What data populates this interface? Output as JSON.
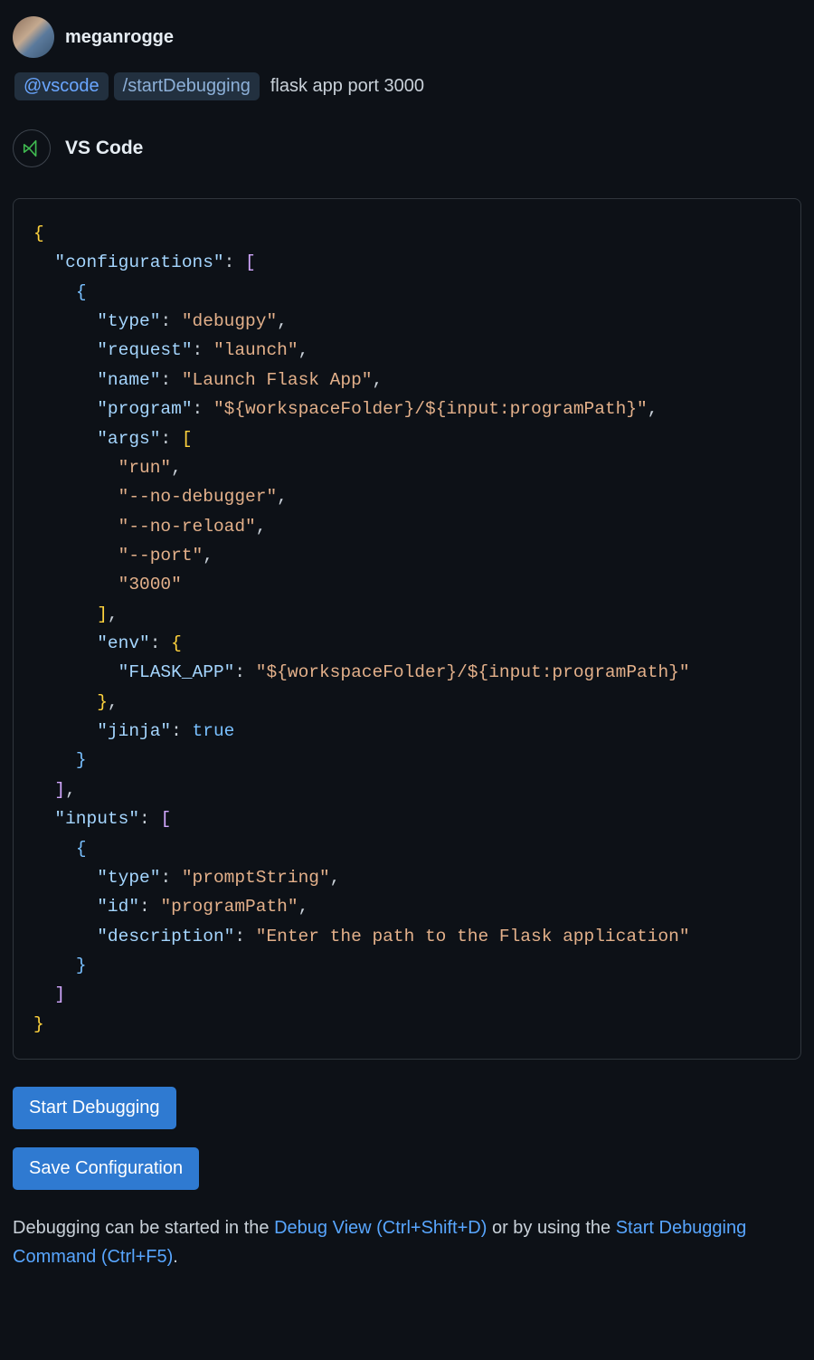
{
  "user": {
    "name": "meganrogge"
  },
  "prompt": {
    "agent_chip": "@vscode",
    "command_chip": "/startDebugging",
    "query_text": "flask app port 3000"
  },
  "agent": {
    "name": "VS Code"
  },
  "code": {
    "lines": [
      [
        [
          "{",
          "brace"
        ]
      ],
      [
        [
          "  ",
          ""
        ],
        [
          "\"configurations\"",
          "key"
        ],
        [
          ": ",
          "punct"
        ],
        [
          "[",
          "bracket-purple"
        ]
      ],
      [
        [
          "    ",
          ""
        ],
        [
          "{",
          "bracket-blue"
        ]
      ],
      [
        [
          "      ",
          ""
        ],
        [
          "\"type\"",
          "key"
        ],
        [
          ": ",
          "punct"
        ],
        [
          "\"debugpy\"",
          "string"
        ],
        [
          ",",
          "punct"
        ]
      ],
      [
        [
          "      ",
          ""
        ],
        [
          "\"request\"",
          "key"
        ],
        [
          ": ",
          "punct"
        ],
        [
          "\"launch\"",
          "string"
        ],
        [
          ",",
          "punct"
        ]
      ],
      [
        [
          "      ",
          ""
        ],
        [
          "\"name\"",
          "key"
        ],
        [
          ": ",
          "punct"
        ],
        [
          "\"Launch Flask App\"",
          "string"
        ],
        [
          ",",
          "punct"
        ]
      ],
      [
        [
          "      ",
          ""
        ],
        [
          "\"program\"",
          "key"
        ],
        [
          ": ",
          "punct"
        ],
        [
          "\"${workspaceFolder}/${input:programPath}\"",
          "string"
        ],
        [
          ",",
          "punct"
        ]
      ],
      [
        [
          "      ",
          ""
        ],
        [
          "\"args\"",
          "key"
        ],
        [
          ": ",
          "punct"
        ],
        [
          "[",
          "brace"
        ]
      ],
      [
        [
          "        ",
          ""
        ],
        [
          "\"run\"",
          "string"
        ],
        [
          ",",
          "punct"
        ]
      ],
      [
        [
          "        ",
          ""
        ],
        [
          "\"--no-debugger\"",
          "string"
        ],
        [
          ",",
          "punct"
        ]
      ],
      [
        [
          "        ",
          ""
        ],
        [
          "\"--no-reload\"",
          "string"
        ],
        [
          ",",
          "punct"
        ]
      ],
      [
        [
          "        ",
          ""
        ],
        [
          "\"--port\"",
          "string"
        ],
        [
          ",",
          "punct"
        ]
      ],
      [
        [
          "        ",
          ""
        ],
        [
          "\"3000\"",
          "string"
        ]
      ],
      [
        [
          "      ",
          ""
        ],
        [
          "]",
          "brace"
        ],
        [
          ",",
          "punct"
        ]
      ],
      [
        [
          "      ",
          ""
        ],
        [
          "\"env\"",
          "key"
        ],
        [
          ": ",
          "punct"
        ],
        [
          "{",
          "brace"
        ]
      ],
      [
        [
          "        ",
          ""
        ],
        [
          "\"FLASK_APP\"",
          "key"
        ],
        [
          ": ",
          "punct"
        ],
        [
          "\"${workspaceFolder}/${input:programPath}\"",
          "string"
        ]
      ],
      [
        [
          "      ",
          ""
        ],
        [
          "}",
          "brace"
        ],
        [
          ",",
          "punct"
        ]
      ],
      [
        [
          "      ",
          ""
        ],
        [
          "\"jinja\"",
          "key"
        ],
        [
          ": ",
          "punct"
        ],
        [
          "true",
          "bool"
        ]
      ],
      [
        [
          "    ",
          ""
        ],
        [
          "}",
          "bracket-blue"
        ]
      ],
      [
        [
          "  ",
          ""
        ],
        [
          "]",
          "bracket-purple"
        ],
        [
          ",",
          "punct"
        ]
      ],
      [
        [
          "  ",
          ""
        ],
        [
          "\"inputs\"",
          "key"
        ],
        [
          ": ",
          "punct"
        ],
        [
          "[",
          "bracket-purple"
        ]
      ],
      [
        [
          "    ",
          ""
        ],
        [
          "{",
          "bracket-blue"
        ]
      ],
      [
        [
          "      ",
          ""
        ],
        [
          "\"type\"",
          "key"
        ],
        [
          ": ",
          "punct"
        ],
        [
          "\"promptString\"",
          "string"
        ],
        [
          ",",
          "punct"
        ]
      ],
      [
        [
          "      ",
          ""
        ],
        [
          "\"id\"",
          "key"
        ],
        [
          ": ",
          "punct"
        ],
        [
          "\"programPath\"",
          "string"
        ],
        [
          ",",
          "punct"
        ]
      ],
      [
        [
          "      ",
          ""
        ],
        [
          "\"description\"",
          "key"
        ],
        [
          ": ",
          "punct"
        ],
        [
          "\"Enter the path to the Flask application\"",
          "string"
        ]
      ],
      [
        [
          "    ",
          ""
        ],
        [
          "}",
          "bracket-blue"
        ]
      ],
      [
        [
          "  ",
          ""
        ],
        [
          "]",
          "bracket-purple"
        ]
      ],
      [
        [
          "}",
          "brace"
        ]
      ]
    ]
  },
  "buttons": {
    "start_debugging": "Start Debugging",
    "save_configuration": "Save Configuration"
  },
  "footer": {
    "part1": "Debugging can be started in the ",
    "link1": "Debug View (Ctrl+Shift+D)",
    "part2": " or by using the ",
    "link2": "Start Debugging Command (Ctrl+F5)",
    "part3": "."
  }
}
